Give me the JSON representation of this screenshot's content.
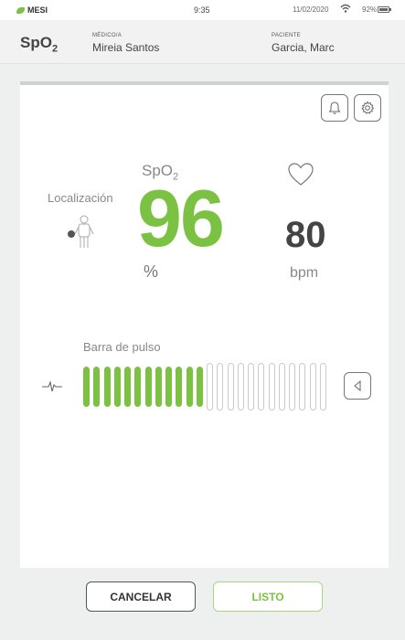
{
  "statusbar": {
    "brand": "MESI",
    "time": "9:35",
    "date": "11/02/2020",
    "battery": "92%"
  },
  "header": {
    "title_main": "SpO",
    "title_sub": "2",
    "doctor_label": "MÉDICO/A",
    "doctor_value": "Mireia Santos",
    "patient_label": "PACIENTE",
    "patient_value": "Garcia, Marc"
  },
  "measure": {
    "spo2_label_main": "SpO",
    "spo2_label_sub": "2",
    "spo2_value": "96",
    "spo2_unit": "%",
    "location_label": "Localización",
    "pulse_value": "80",
    "pulse_unit": "bpm",
    "pulse_bar_label": "Barra de pulso",
    "pulse_bar_level": 0.5,
    "pulse_bar_segments": 24
  },
  "icons": {
    "bell": "bell-icon",
    "gear": "gear-icon",
    "heart": "heart-icon",
    "person": "person-icon",
    "pulse": "pulse-wave-icon",
    "sound": "speaker-icon"
  },
  "colors": {
    "accent": "#7cc242",
    "text": "#444444"
  },
  "buttons": {
    "cancel": "CANCELAR",
    "done": "LISTO"
  }
}
